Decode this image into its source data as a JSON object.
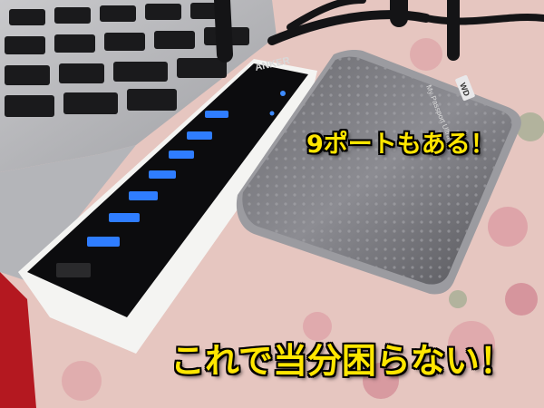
{
  "captions": {
    "top": "9ポートもある！",
    "bottom": "これで当分困らない！"
  },
  "hub": {
    "brand": "ANKER"
  },
  "drive": {
    "logo": "WD",
    "model": "My Passport Ultra"
  },
  "colors": {
    "caption": "#ffe600",
    "caption_outline": "#000000",
    "usb_port_blue": "#2f7dff",
    "tablecloth": "#e8c9c3"
  }
}
